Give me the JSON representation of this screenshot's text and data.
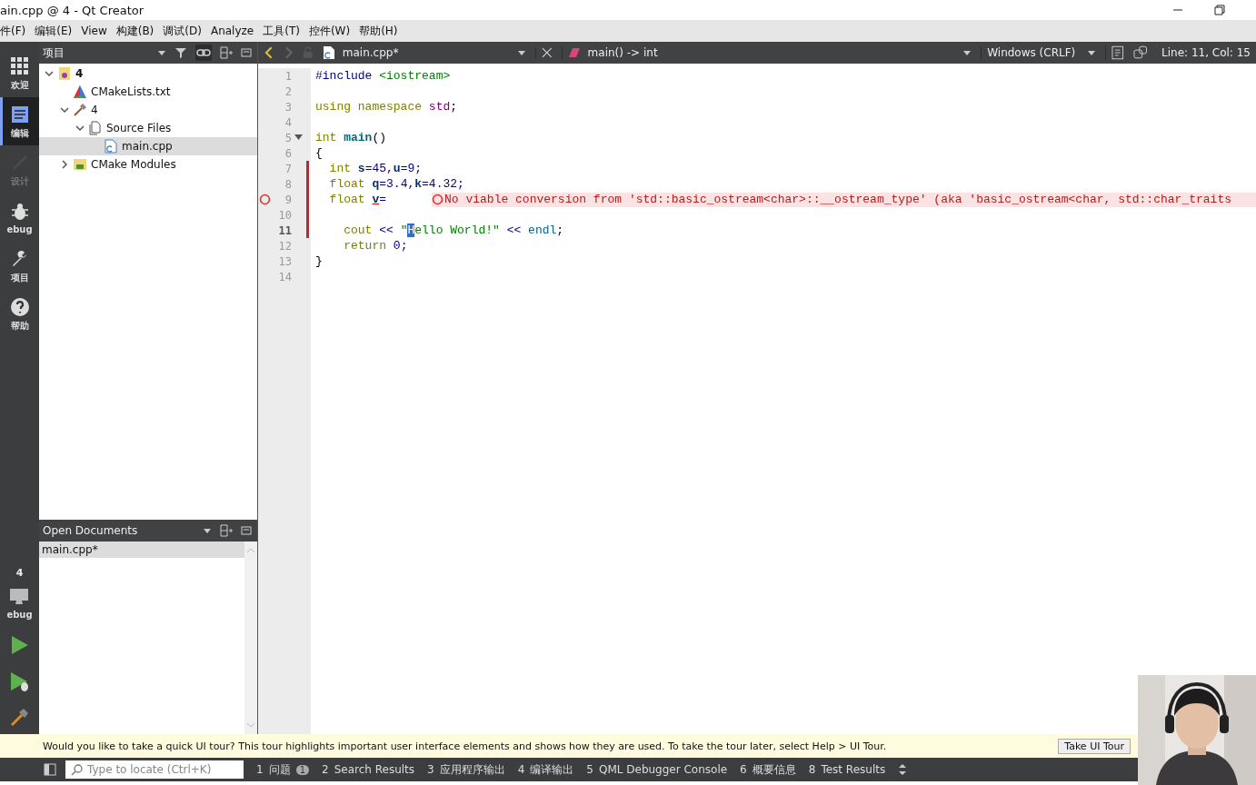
{
  "window": {
    "title": "ain.cpp @ 4 - Qt Creator"
  },
  "menu": [
    "件(F)",
    "编辑(E)",
    "View",
    "构建(B)",
    "调试(D)",
    "Analyze",
    "工具(T)",
    "控件(W)",
    "帮助(H)"
  ],
  "mode_bar": {
    "modes": [
      {
        "label": "欢迎",
        "kind": "welcome",
        "selected": false,
        "disabled": false
      },
      {
        "label": "编辑",
        "kind": "edit",
        "selected": true,
        "disabled": false
      },
      {
        "label": "设计",
        "kind": "design",
        "selected": false,
        "disabled": true
      },
      {
        "label": "ebug",
        "kind": "debug",
        "selected": false,
        "disabled": false
      },
      {
        "label": "项目",
        "kind": "projects",
        "selected": false,
        "disabled": false
      },
      {
        "label": "帮助",
        "kind": "help",
        "selected": false,
        "disabled": false
      }
    ],
    "target": {
      "project": "4",
      "label": "ebug"
    }
  },
  "project_pane": {
    "title": "项目",
    "tree": [
      {
        "name": "4",
        "kind": "project",
        "expanded": true,
        "selected": false,
        "children": [
          {
            "name": "CMakeLists.txt",
            "kind": "cmake",
            "selected": false
          },
          {
            "name": "4",
            "kind": "target",
            "expanded": true,
            "selected": false,
            "children": [
              {
                "name": "Source Files",
                "kind": "folder",
                "expanded": true,
                "selected": false,
                "children": [
                  {
                    "name": "main.cpp",
                    "kind": "cpp",
                    "selected": true
                  }
                ]
              }
            ]
          },
          {
            "name": "CMake Modules",
            "kind": "modules",
            "expanded": false,
            "selected": false
          }
        ]
      }
    ]
  },
  "open_documents": {
    "title": "Open Documents",
    "items": [
      {
        "name": "main.cpp*",
        "selected": true
      }
    ]
  },
  "editor": {
    "file": "main.cpp*",
    "symbol": "main() -> int",
    "line_ending": "Windows (CRLF)",
    "position": "Line: 11, Col: 15",
    "lines": [
      {
        "number": "1",
        "modified": false,
        "error": false,
        "current": false,
        "foldable": false,
        "tokens": [
          {
            "text": "#include ",
            "kind": "pre"
          },
          {
            "text": "<iostream>",
            "kind": "str"
          }
        ]
      },
      {
        "number": "2",
        "modified": false,
        "error": false,
        "current": false,
        "foldable": false
      },
      {
        "number": "3",
        "modified": false,
        "error": false,
        "current": false,
        "foldable": false,
        "tokens": [
          {
            "text": "using namespace ",
            "kind": "kw"
          },
          {
            "text": "std",
            "kind": "ns"
          },
          {
            "text": ";",
            "kind": "plain"
          }
        ]
      },
      {
        "number": "4",
        "modified": false,
        "error": false,
        "current": false,
        "foldable": false
      },
      {
        "number": "5",
        "modified": false,
        "error": false,
        "current": false,
        "foldable": true,
        "tokens": [
          {
            "text": "int ",
            "kind": "kw"
          },
          {
            "text": "main",
            "kind": "fn"
          },
          {
            "text": "()",
            "kind": "plain"
          }
        ]
      },
      {
        "number": "6",
        "modified": false,
        "error": false,
        "current": false,
        "foldable": false,
        "tokens": [
          {
            "text": "{",
            "kind": "plain"
          }
        ]
      },
      {
        "number": "7",
        "modified": true,
        "error": false,
        "current": false,
        "foldable": false,
        "tokens": [
          {
            "text": "  int ",
            "kind": "kw"
          },
          {
            "text": "s",
            "kind": "var"
          },
          {
            "text": "=45,",
            "kind": "num"
          },
          {
            "text": "u",
            "kind": "var"
          },
          {
            "text": "=9;",
            "kind": "num"
          }
        ]
      },
      {
        "number": "8",
        "modified": true,
        "error": false,
        "current": false,
        "foldable": false,
        "tokens": [
          {
            "text": "  float ",
            "kind": "kw"
          },
          {
            "text": "q",
            "kind": "var"
          },
          {
            "text": "=3.4,",
            "kind": "num"
          },
          {
            "text": "k",
            "kind": "var"
          },
          {
            "text": "=4.32;",
            "kind": "num"
          }
        ]
      },
      {
        "number": "9",
        "modified": true,
        "error": true,
        "current": false,
        "foldable": false,
        "annotation": "No viable conversion from 'std::basic_ostream<char>::__ostream_type' (aka 'basic_ostream<char, std::char_traits",
        "tokens": [
          {
            "text": "  float ",
            "kind": "kw"
          },
          {
            "text": "v",
            "kind": "err"
          },
          {
            "text": "=",
            "kind": "num"
          }
        ]
      },
      {
        "number": "10",
        "modified": true,
        "error": false,
        "current": false,
        "foldable": false
      },
      {
        "number": "11",
        "modified": true,
        "error": false,
        "current": true,
        "foldable": false,
        "tokens": [
          {
            "text": "    cout ",
            "kind": "kw"
          },
          {
            "text": "<< ",
            "kind": "num"
          },
          {
            "text": "\"",
            "kind": "str"
          },
          {
            "text": "H",
            "kind": "sel"
          },
          {
            "text": "ello World!\" ",
            "kind": "str"
          },
          {
            "text": "<< ",
            "kind": "num"
          },
          {
            "text": "endl",
            "kind": "id"
          },
          {
            "text": ";",
            "kind": "plain"
          }
        ]
      },
      {
        "number": "12",
        "modified": false,
        "error": false,
        "current": false,
        "foldable": false,
        "tokens": [
          {
            "text": "    return ",
            "kind": "kw"
          },
          {
            "text": "0;",
            "kind": "num"
          }
        ]
      },
      {
        "number": "13",
        "modified": false,
        "error": false,
        "current": false,
        "foldable": false,
        "tokens": [
          {
            "text": "}",
            "kind": "plain"
          }
        ]
      },
      {
        "number": "14",
        "modified": false,
        "error": false,
        "current": false,
        "foldable": false
      }
    ]
  },
  "tour_bar": {
    "message": "Would you like to take a quick UI tour? This tour highlights important user interface elements and shows how they are used. To take the tour later, select Help > UI Tour.",
    "button": "Take UI Tour"
  },
  "output_bar": {
    "locate_placeholder": "Type to locate (Ctrl+K)",
    "tabs": [
      {
        "number": "1",
        "label": "问题",
        "badge": "1"
      },
      {
        "number": "2",
        "label": "Search Results"
      },
      {
        "number": "3",
        "label": "应用程序输出"
      },
      {
        "number": "4",
        "label": "编译输出"
      },
      {
        "number": "5",
        "label": "QML Debugger Console"
      },
      {
        "number": "6",
        "label": "概要信息"
      },
      {
        "number": "8",
        "label": "Test Results"
      }
    ]
  }
}
